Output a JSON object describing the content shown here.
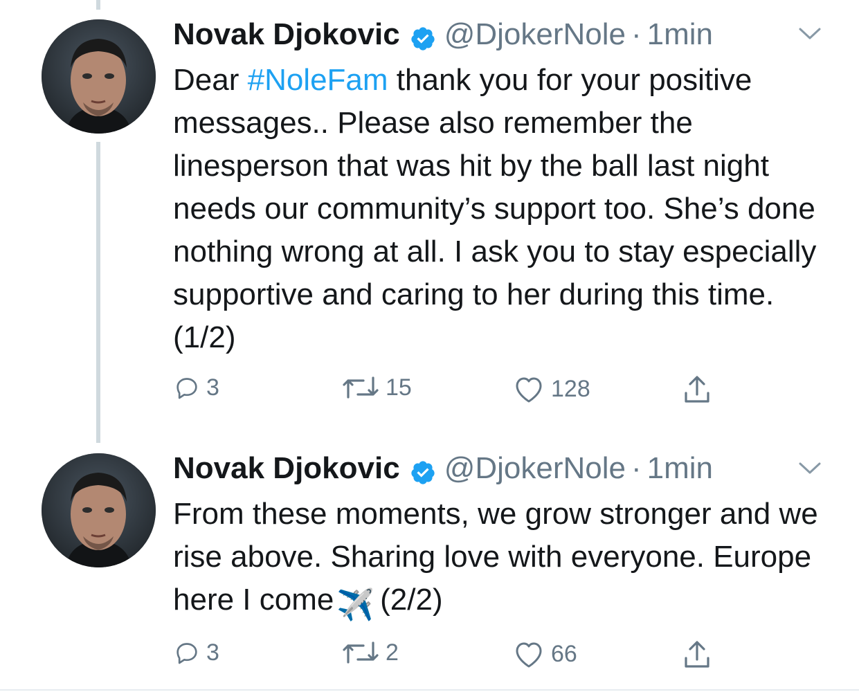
{
  "tweets": [
    {
      "author_name": "Novak Djokovic",
      "handle": "@DjokerNole",
      "separator": "·",
      "time": "1min",
      "text_before": "Dear ",
      "hashtag": "#NoleFam",
      "text_after": " thank you for your positive messages.. Please also remember the linesperson that was hit by the ball last night needs our community’s support too. She’s done nothing wrong at all. I ask you to stay especially supportive and caring to her during this time. (1/2)",
      "replies": "3",
      "retweets": "15",
      "likes": "128"
    },
    {
      "author_name": "Novak Djokovic",
      "handle": "@DjokerNole",
      "separator": "·",
      "time": "1min",
      "text_before": "From these moments, we grow stronger and we rise above. Sharing love with everyone. Europe here I come",
      "emoji": "✈️",
      "text_after": "(2/2)",
      "replies": "3",
      "retweets": "2",
      "likes": "66"
    }
  ],
  "icons": {
    "verified": "verified-badge-icon",
    "menu": "chevron-down-icon",
    "reply": "reply-icon",
    "retweet": "retweet-icon",
    "like": "heart-icon",
    "share": "share-icon"
  },
  "colors": {
    "link": "#1da1f2",
    "secondary_text": "#657786",
    "thread_line": "#cfd9de"
  }
}
